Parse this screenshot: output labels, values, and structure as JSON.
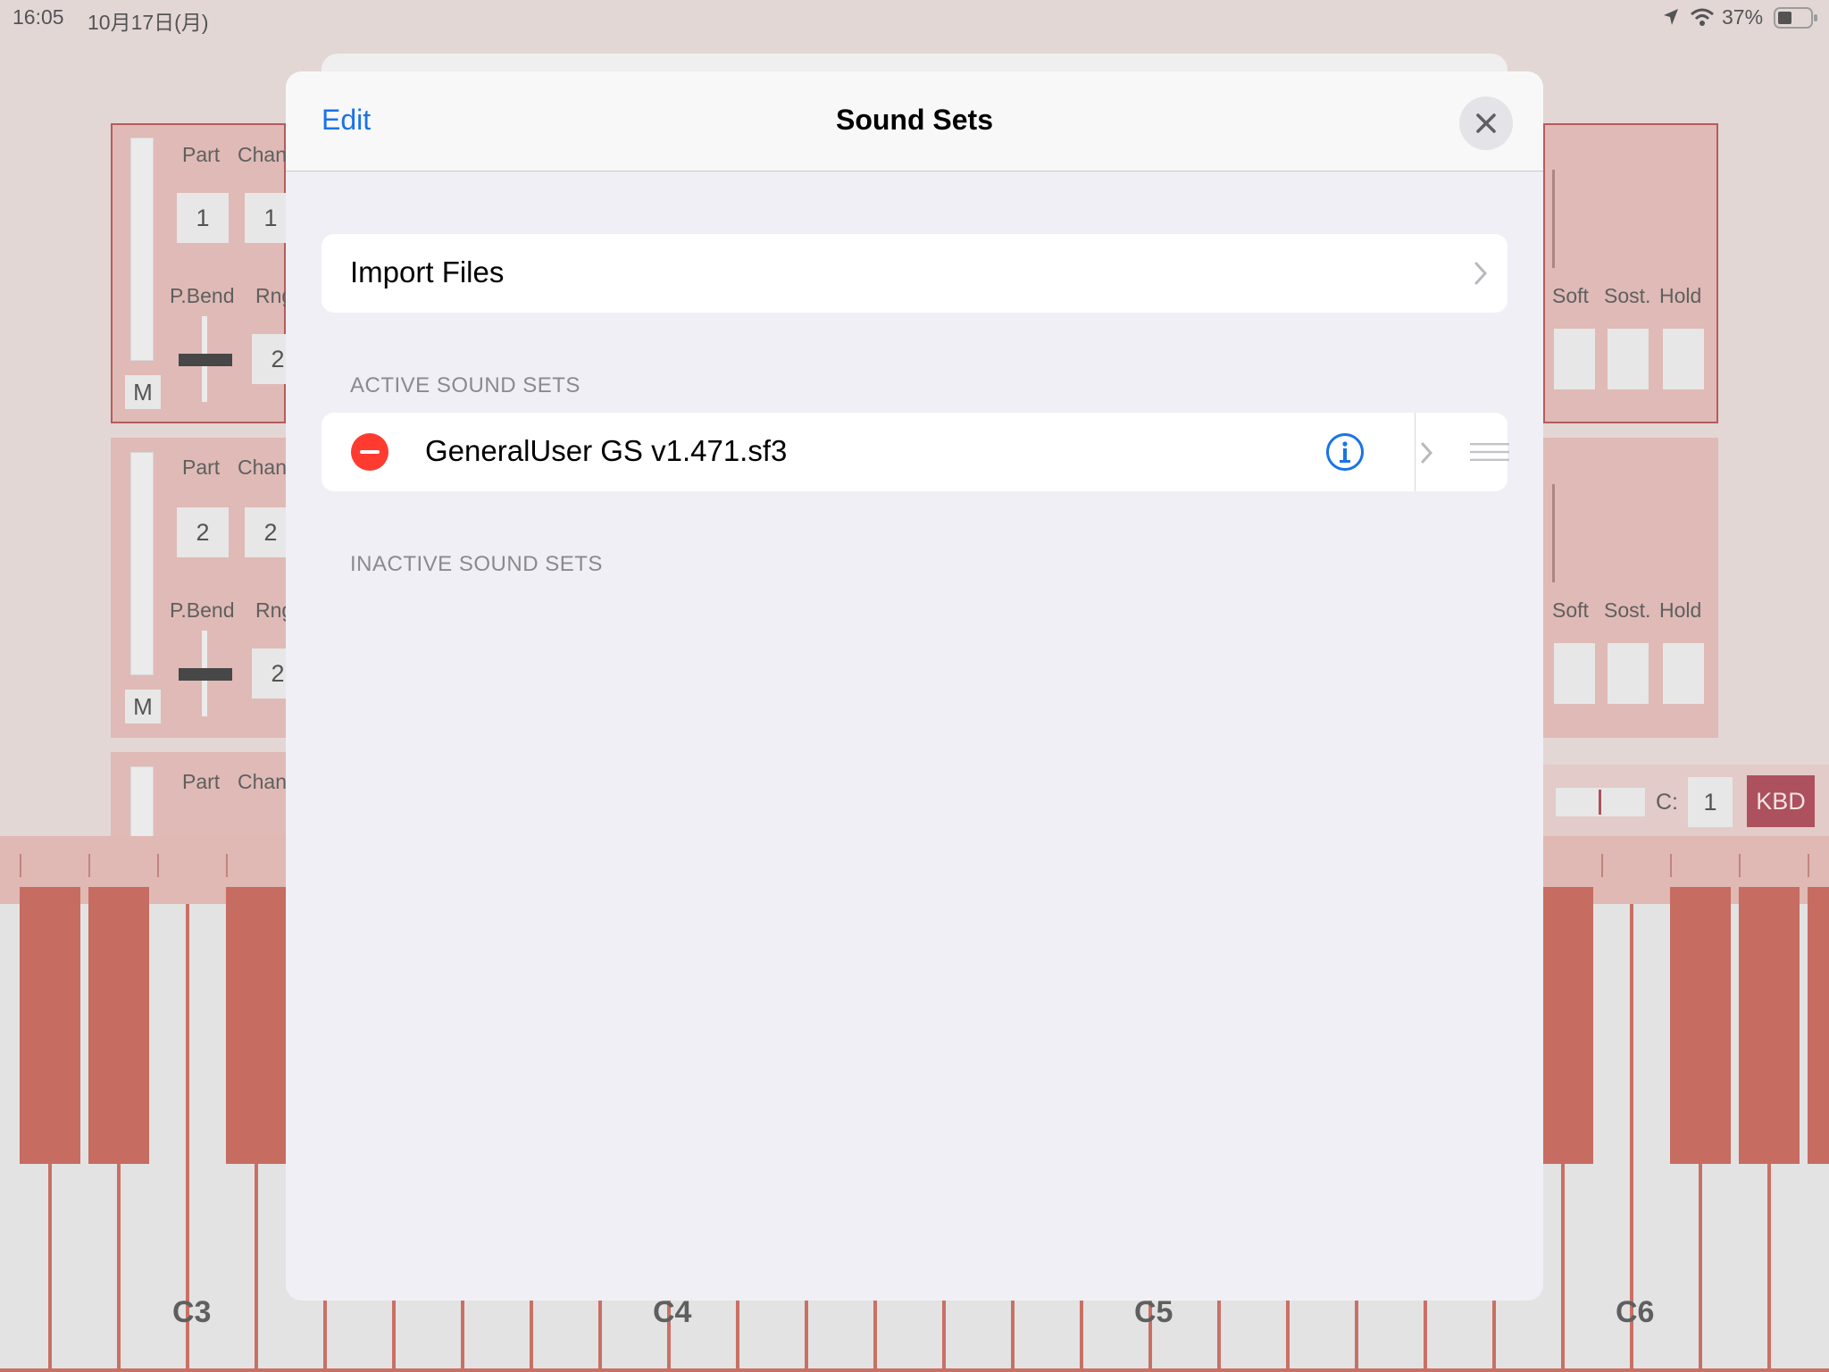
{
  "status_bar": {
    "time": "16:05",
    "date": "10月17日(月)",
    "battery": "37%"
  },
  "background_app": {
    "parts": [
      {
        "part_label": "Part",
        "channel_label": "Chan",
        "part_value": "1",
        "channel_value": "1",
        "pbend_label": "P.Bend",
        "range_label": "Rng",
        "range_value": "2",
        "mute_label": "M"
      },
      {
        "part_label": "Part",
        "channel_label": "Chan",
        "part_value": "2",
        "channel_value": "2",
        "pbend_label": "P.Bend",
        "range_label": "Rng",
        "range_value": "2",
        "mute_label": "M"
      },
      {
        "part_label": "Part",
        "channel_label": "Chan"
      }
    ],
    "pedals": {
      "soft": "Soft",
      "sost": "Sost.",
      "hold": "Hold"
    },
    "channel_label": "C:",
    "channel_value": "1",
    "kbd_button": "KBD",
    "octave_labels": [
      "C3",
      "C4",
      "C5",
      "C6"
    ],
    "accent_color": "#8c0f1f",
    "black_key_color": "#b13424"
  },
  "modal": {
    "edit_label": "Edit",
    "title": "Sound Sets",
    "close_icon": "close-icon",
    "import_files_label": "Import Files",
    "active_header": "ACTIVE SOUND SETS",
    "active_items": [
      {
        "name": "GeneralUser GS v1.471.sf3"
      }
    ],
    "inactive_header": "INACTIVE SOUND SETS",
    "link_color": "#1a73e8",
    "delete_color": "#ff3b30"
  }
}
